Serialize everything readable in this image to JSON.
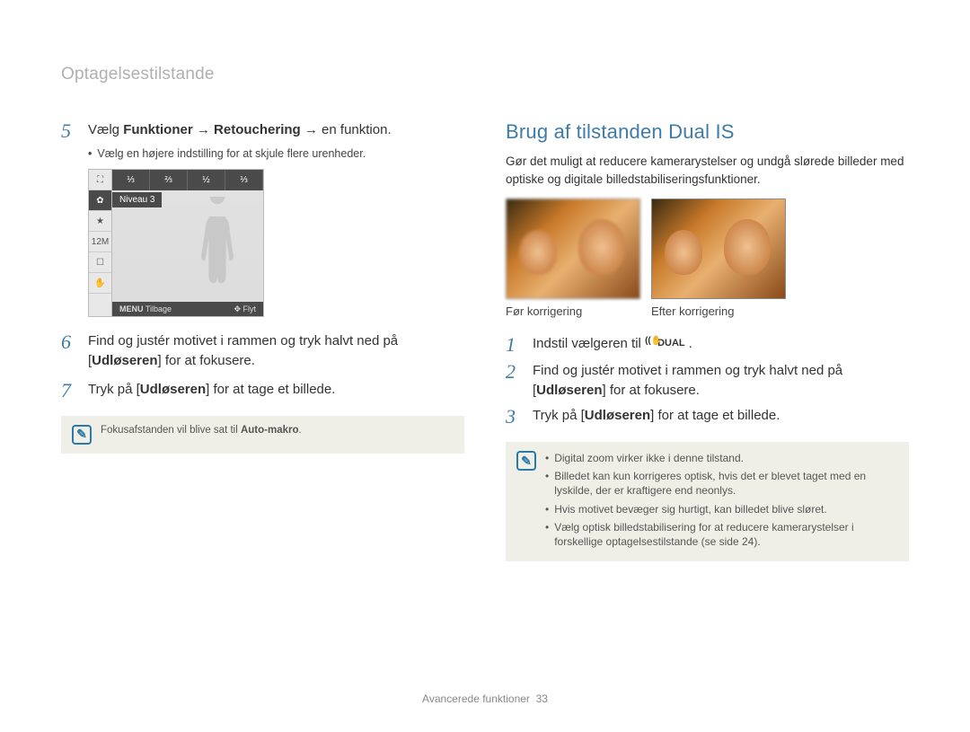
{
  "header": "Optagelsestilstande",
  "left": {
    "step5_pre": "Vælg ",
    "step5_b1": "Funktioner",
    "step5_arrow": " → ",
    "step5_b2": "Retouchering",
    "step5_post": " → en funktion.",
    "step5_sub": "Vælg en højere indstilling for at skjule flere urenheder.",
    "camera_level_label": "Niveau 3",
    "camera_back": "Tilbage",
    "camera_back_label": "MENU",
    "camera_move": "Flyt",
    "camera_top_icons": [
      "⅓",
      "⅔",
      "½",
      "⅓"
    ],
    "camera_left_icons": [
      "⛶",
      "✿",
      "★",
      "12M",
      "☐",
      "✋"
    ],
    "step6_pre": "Find og justér motivet i rammen og tryk halvt ned på [",
    "step6_b": "Udløseren",
    "step6_post": "] for at fokusere.",
    "step7_pre": "Tryk på [",
    "step7_b": "Udløseren",
    "step7_post": "] for at tage et billede.",
    "note_pre": "Fokusafstanden vil blive sat til ",
    "note_b": "Auto-makro",
    "note_post": "."
  },
  "right": {
    "title": "Brug af tilstanden Dual IS",
    "intro": "Gør det muligt at reducere kamerarystelser og undgå slørede billeder med optiske og digitale billedstabiliseringsfunktioner.",
    "caption_before": "Før korrigering",
    "caption_after": "Efter korrigering",
    "step1_pre": "Indstil vælgeren til ",
    "step1_icon_text": "DUAL",
    "step1_post": " .",
    "step2_pre": "Find og justér motivet i rammen og tryk halvt ned på [",
    "step2_b": "Udløseren",
    "step2_post": "] for at fokusere.",
    "step3_pre": "Tryk på [",
    "step3_b": "Udløseren",
    "step3_post": "] for at tage et billede.",
    "notes": [
      "Digital zoom virker ikke i denne tilstand.",
      "Billedet kan kun korrigeres optisk, hvis det er blevet taget med en lyskilde, der er kraftigere end neonlys.",
      "Hvis motivet bevæger sig hurtigt, kan billedet blive sløret.",
      "Vælg optisk billedstabilisering for at reducere kamerarystelser i forskellige optagelsestilstande (se side 24)."
    ]
  },
  "footer_label": "Avancerede funktioner",
  "footer_page": "33"
}
